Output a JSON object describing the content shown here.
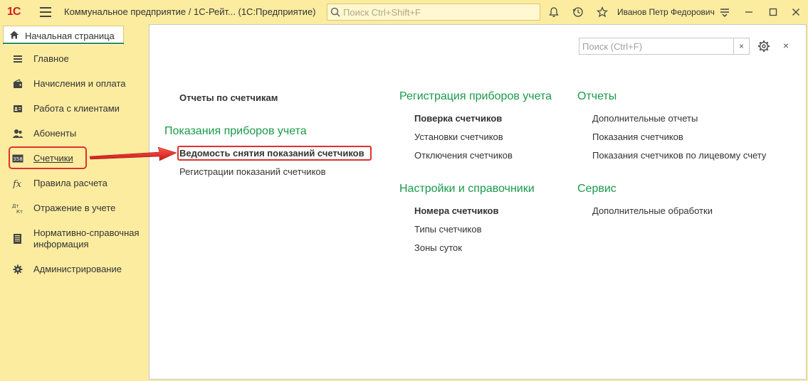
{
  "titlebar": {
    "logo": "1С",
    "app_title": "Коммунальное предприятие / 1С-Рейт...  (1С:Предприятие)",
    "search_placeholder": "Поиск Ctrl+Shift+F",
    "user_name": "Иванов Петр Федорович"
  },
  "tabs": {
    "home_label": "Начальная страница"
  },
  "sidebar": {
    "items": [
      {
        "label": "Главное",
        "icon": "list-icon"
      },
      {
        "label": "Начисления и оплата",
        "icon": "wallet-icon"
      },
      {
        "label": "Работа с клиентами",
        "icon": "contacts-icon"
      },
      {
        "label": "Абоненты",
        "icon": "users-icon"
      },
      {
        "label": "Счетчики",
        "icon": "meter-icon"
      },
      {
        "label": "Правила расчета",
        "icon": "fx-icon"
      },
      {
        "label": "Отражение в учете",
        "icon": "debit-credit-icon"
      },
      {
        "label": "Нормативно-справочная",
        "label2": "информация",
        "icon": "book-icon"
      },
      {
        "label": "Администрирование",
        "icon": "gear-icon"
      }
    ],
    "selected": "Счетчики"
  },
  "main": {
    "search_placeholder": "Поиск (Ctrl+F)",
    "search_clear": "×",
    "close": "×",
    "col1": {
      "top_link": "Отчеты по счетчикам",
      "group_title": "Показания приборов учета",
      "links": [
        "Ведомость снятия показаний счетчиков",
        "Регистрации показаний счетчиков"
      ]
    },
    "col2": {
      "group1_title": "Регистрация приборов учета",
      "group1_links": [
        "Поверка счетчиков",
        "Установки счетчиков",
        "Отключения счетчиков"
      ],
      "group2_title": "Настройки и справочники",
      "group2_links": [
        "Номера счетчиков",
        "Типы счетчиков",
        "Зоны суток"
      ]
    },
    "col3": {
      "group1_title": "Отчеты",
      "group1_links": [
        "Дополнительные отчеты",
        "Показания счетчиков",
        "Показания счетчиков по лицевому счету"
      ],
      "group2_title": "Сервис",
      "group2_links": [
        "Дополнительные обработки"
      ]
    }
  },
  "colors": {
    "accent_green": "#1a9a4a",
    "highlight_red": "#e03030",
    "sidebar_bg": "#fbeca0"
  }
}
